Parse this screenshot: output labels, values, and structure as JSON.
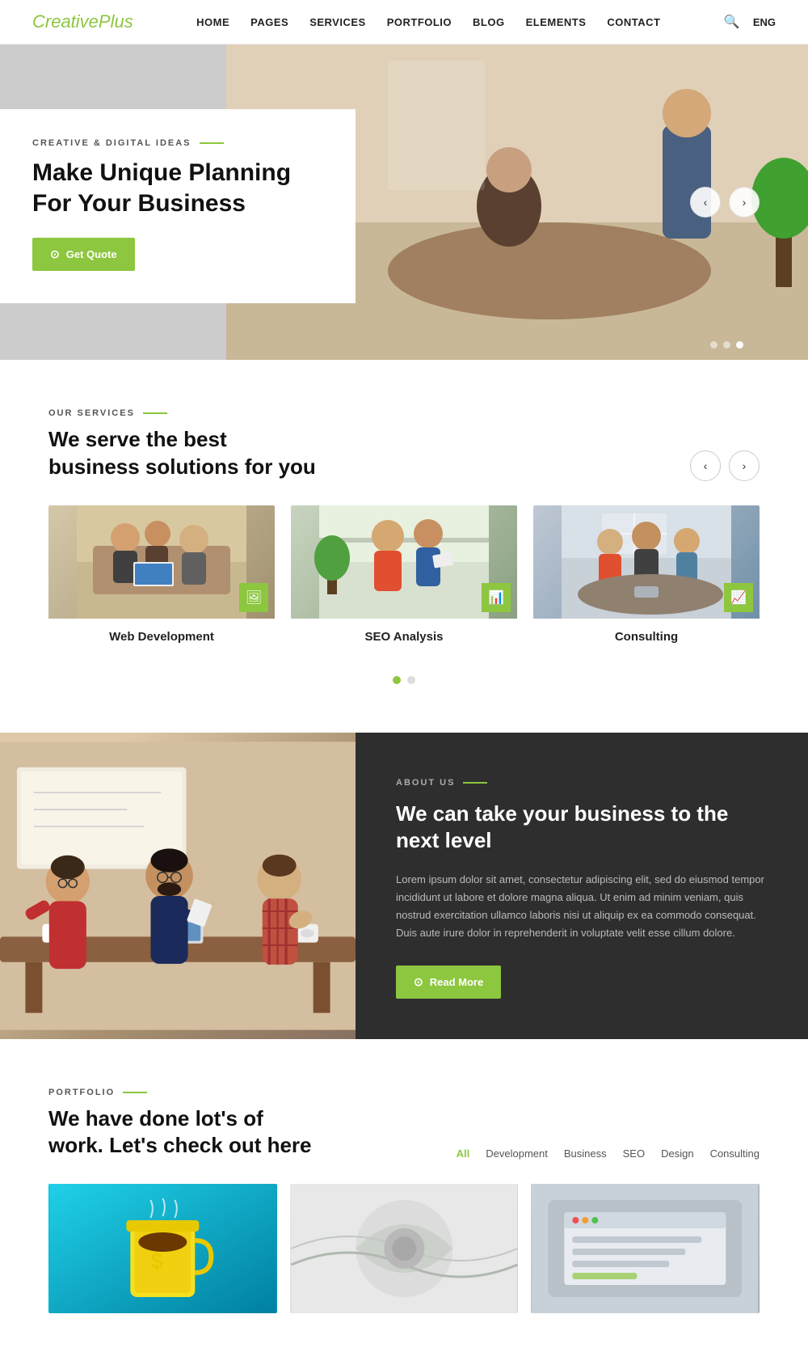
{
  "brand": {
    "name_bold": "Creative",
    "name_italic": "Plus"
  },
  "nav": {
    "links": [
      {
        "label": "HOME",
        "id": "home"
      },
      {
        "label": "PAGES",
        "id": "pages"
      },
      {
        "label": "SERVICES",
        "id": "services"
      },
      {
        "label": "PORTFOLIO",
        "id": "portfolio"
      },
      {
        "label": "BLOG",
        "id": "blog"
      },
      {
        "label": "ELEMENTS",
        "id": "elements"
      },
      {
        "label": "CONTACT",
        "id": "contact"
      }
    ],
    "lang": "ENG"
  },
  "hero": {
    "label": "CREATIVE & DIGITAL IDEAS",
    "title": "Make Unique Planning For Your Business",
    "cta": "Get Quote",
    "dots": [
      {
        "active": false
      },
      {
        "active": false
      },
      {
        "active": true
      }
    ]
  },
  "services": {
    "label": "OUR SERVICES",
    "title_line1": "We serve the best",
    "title_line2": "business solutions for you",
    "cards": [
      {
        "title": "Web Development",
        "icon": "🖼"
      },
      {
        "title": "SEO Analysis",
        "icon": "📊"
      },
      {
        "title": "Consulting",
        "icon": "📈"
      }
    ],
    "dots": [
      {
        "active": true
      },
      {
        "active": false
      }
    ]
  },
  "about": {
    "label": "ABOUT US",
    "title": "We can take your business to the next level",
    "text": "Lorem ipsum dolor sit amet, consectetur adipiscing elit, sed do eiusmod tempor incididunt ut labore et dolore magna aliqua. Ut enim ad minim veniam, quis nostrud exercitation ullamco laboris nisi ut aliquip ex ea commodo consequat. Duis aute irure dolor in reprehenderit in voluptate velit esse cillum dolore.",
    "cta": "Read More"
  },
  "portfolio": {
    "label": "PORTFOLIO",
    "title_line1": "We have done lot's of",
    "title_line2": "work. Let's check out here",
    "filters": [
      {
        "label": "All",
        "active": true
      },
      {
        "label": "Development",
        "active": false
      },
      {
        "label": "Business",
        "active": false
      },
      {
        "label": "SEO",
        "active": false
      },
      {
        "label": "Design",
        "active": false
      },
      {
        "label": "Consulting",
        "active": false
      }
    ]
  },
  "colors": {
    "green": "#8dc63f",
    "dark": "#2e2e2e"
  }
}
